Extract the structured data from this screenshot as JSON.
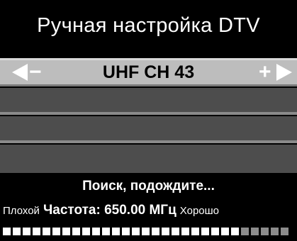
{
  "menu": {
    "title": "Ручная настройка DTV"
  },
  "channel_selector": {
    "decrease_label": "−",
    "channel": "UHF CH 43",
    "increase_label": "+"
  },
  "status": {
    "message": "Поиск, подождите...",
    "signal_low_label": "Плохой",
    "frequency": "Частота: 650.00 МГц",
    "signal_high_label": "Хорошо"
  },
  "signal_meter": {
    "total_segments": 29,
    "filled_segments": 24,
    "filled_color": "#ffffff",
    "empty_color": "#8c8c8c"
  }
}
